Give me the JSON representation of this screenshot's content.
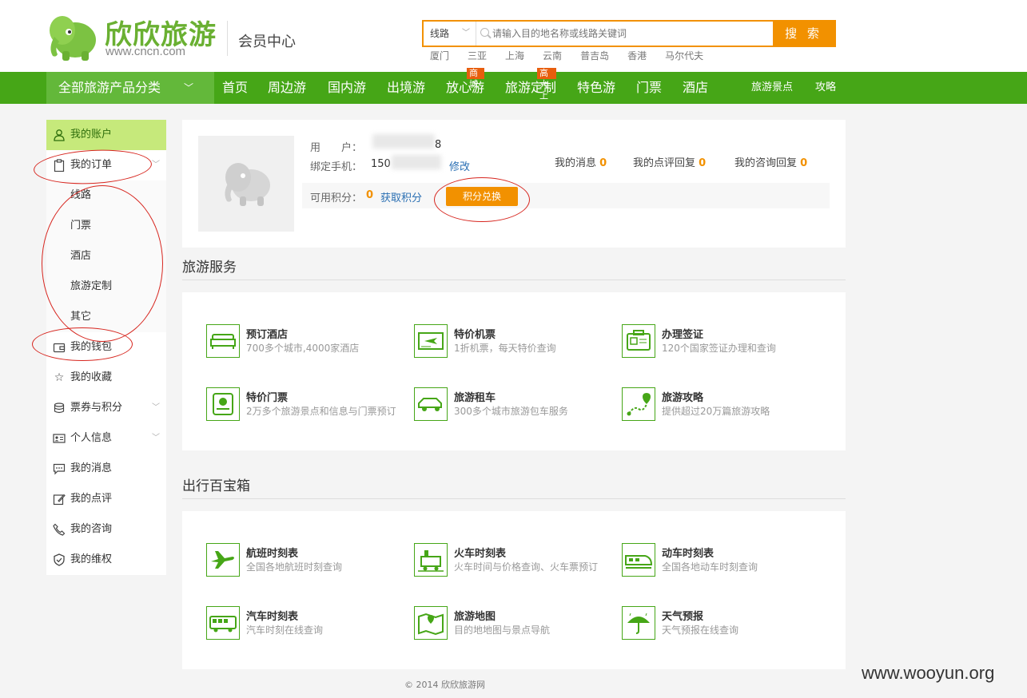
{
  "header": {
    "logo_text": "欣欣旅游",
    "logo_url": "www.cncn.com",
    "member_center": "会员中心",
    "search_type": "线路",
    "search_placeholder": "请输入目的地名称或线路关键词",
    "search_button": "搜 索",
    "hot_destinations": [
      "厦门",
      "三亚",
      "上海",
      "云南",
      "普吉岛",
      "香港",
      "马尔代夫"
    ]
  },
  "nav": {
    "all_categories": "全部旅游产品分类",
    "items": [
      {
        "label": "首页"
      },
      {
        "label": "周边游"
      },
      {
        "label": "国内游"
      },
      {
        "label": "出境游"
      },
      {
        "label": "放心游",
        "tag": "商城"
      },
      {
        "label": "旅游定制",
        "tag": "高大上"
      },
      {
        "label": "特色游"
      },
      {
        "label": "门票"
      },
      {
        "label": "酒店"
      }
    ],
    "right_items": [
      "旅游景点",
      "攻略"
    ]
  },
  "sidebar": {
    "account": "我的账户",
    "orders": "我的订单",
    "order_subitems": [
      "线路",
      "门票",
      "酒店",
      "旅游定制",
      "其它"
    ],
    "items": [
      {
        "label": "我的钱包",
        "icon": "wallet-icon"
      },
      {
        "label": "我的收藏",
        "icon": "star-icon"
      },
      {
        "label": "票券与积分",
        "icon": "coins-icon"
      },
      {
        "label": "个人信息",
        "icon": "id-card-icon"
      },
      {
        "label": "我的消息",
        "icon": "message-icon"
      },
      {
        "label": "我的点评",
        "icon": "edit-icon"
      },
      {
        "label": "我的咨询",
        "icon": "phone-icon"
      },
      {
        "label": "我的维权",
        "icon": "shield-icon"
      }
    ]
  },
  "account": {
    "username_label": "用　　户：",
    "username_value": "8",
    "phone_label": "绑定手机：",
    "phone_value": "150",
    "modify": "修改",
    "my_messages": "我的消息",
    "my_messages_count": "0",
    "review_replies": "我的点评回复",
    "review_replies_count": "0",
    "consult_replies": "我的咨询回复",
    "consult_replies_count": "0",
    "points_label": "可用积分：",
    "points_value": "0",
    "get_points": "获取积分",
    "redeem": "积分兑换"
  },
  "travel_services": {
    "title": "旅游服务",
    "items": [
      {
        "name": "预订酒店",
        "desc": "700多个城市,4000家酒店",
        "icon": "hotel-bed-icon"
      },
      {
        "name": "特价机票",
        "desc": "1折机票，每天特价查询",
        "icon": "plane-ticket-icon"
      },
      {
        "name": "办理签证",
        "desc": "120个国家签证办理和查询",
        "icon": "visa-icon"
      },
      {
        "name": "特价门票",
        "desc": "2万多个旅游景点和信息与门票预订",
        "icon": "ticket-icon"
      },
      {
        "name": "旅游租车",
        "desc": "300多个城市旅游包车服务",
        "icon": "car-icon"
      },
      {
        "name": "旅游攻略",
        "desc": "提供超过20万篇旅游攻略",
        "icon": "route-map-icon"
      }
    ]
  },
  "toolbox": {
    "title": "出行百宝箱",
    "items": [
      {
        "name": "航班时刻表",
        "desc": "全国各地航班时刻查询",
        "icon": "airplane-icon"
      },
      {
        "name": "火车时刻表",
        "desc": "火车时间与价格查询、火车票预订",
        "icon": "train-icon"
      },
      {
        "name": "动车时刻表",
        "desc": "全国各地动车时刻查询",
        "icon": "bullet-train-icon"
      },
      {
        "name": "汽车时刻表",
        "desc": "汽车时刻在线查询",
        "icon": "bus-icon"
      },
      {
        "name": "旅游地图",
        "desc": "目的地地图与景点导航",
        "icon": "map-icon"
      },
      {
        "name": "天气预报",
        "desc": "天气预报在线查询",
        "icon": "umbrella-icon"
      }
    ]
  },
  "footer": "© 2014 欣欣旅游网",
  "watermark": "www.wooyun.org",
  "colors": {
    "brand_green": "#46a617",
    "nav_light_green": "#63b83a",
    "accent_orange": "#f29100",
    "annotation_red": "#d7261f"
  }
}
